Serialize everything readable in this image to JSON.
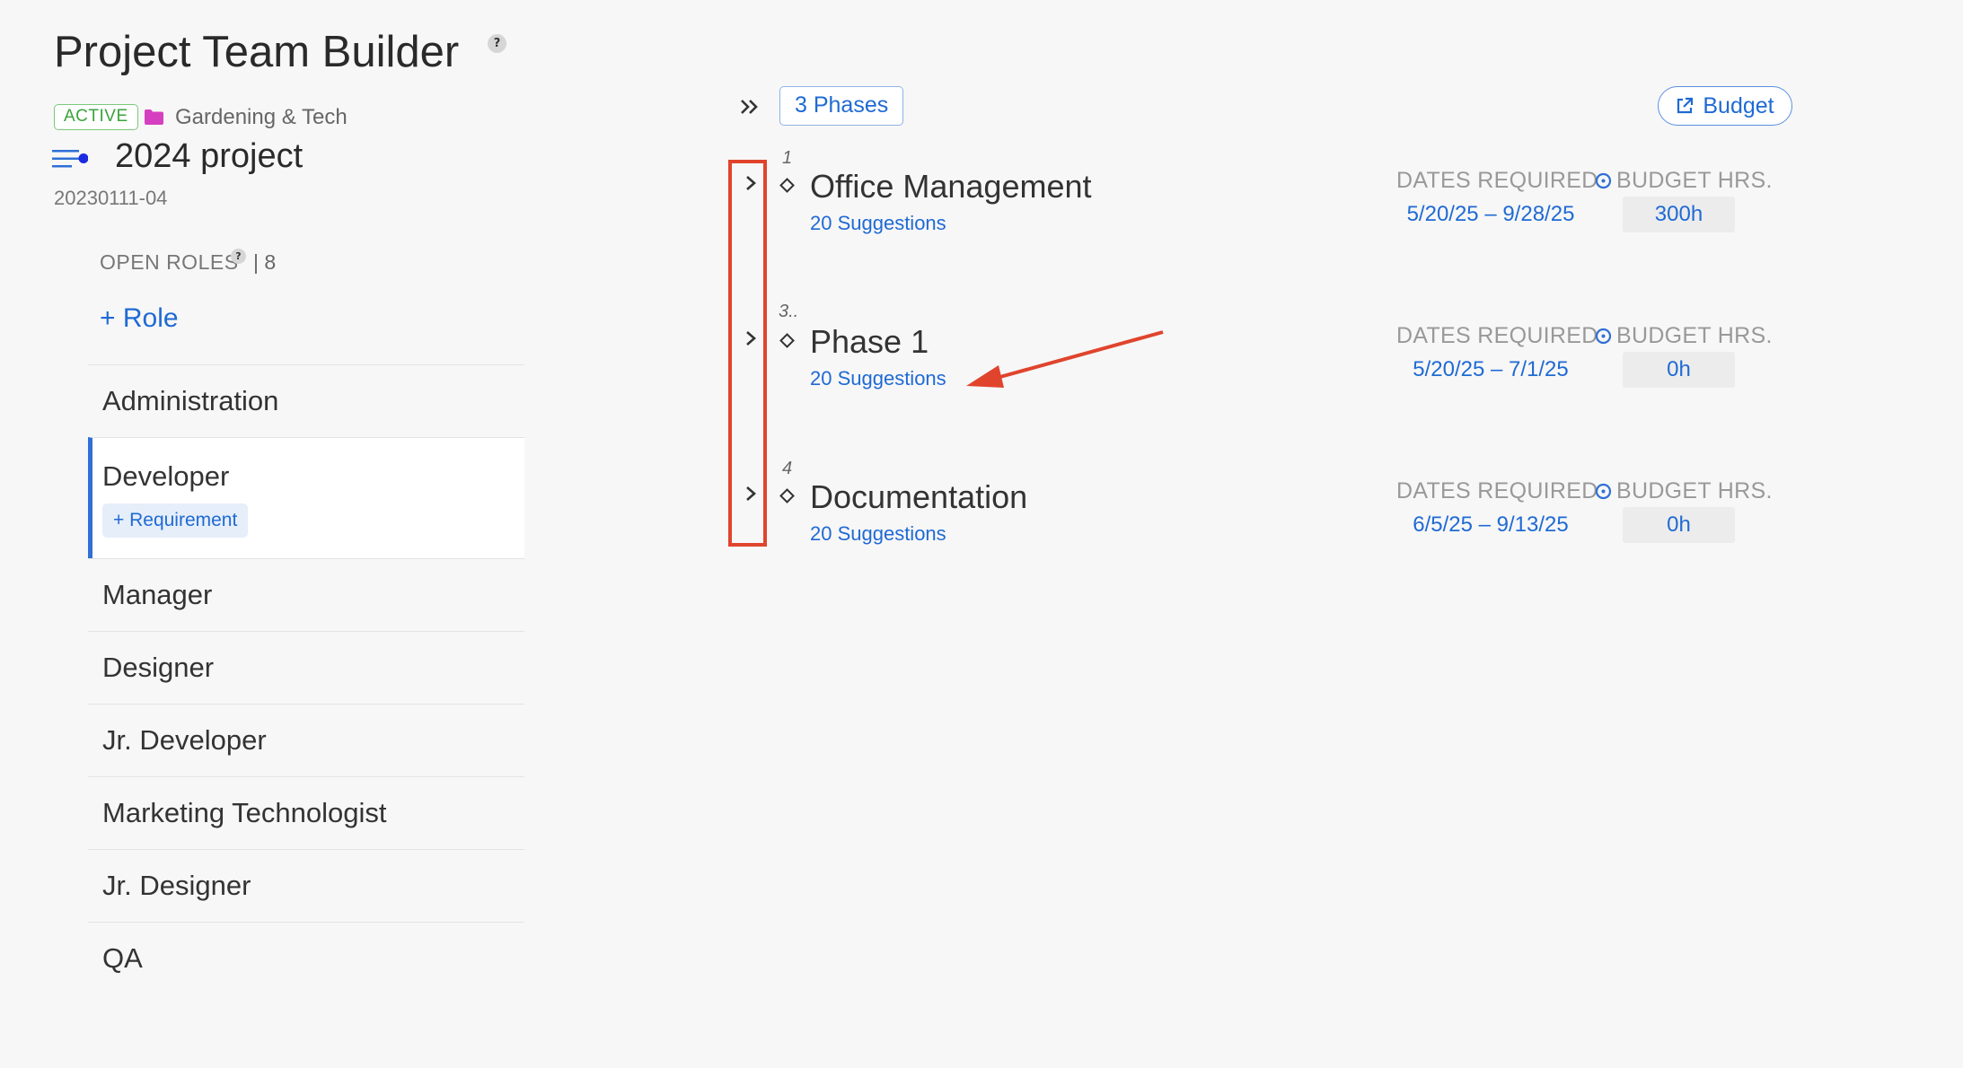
{
  "header": {
    "title": "Project Team Builder",
    "help": "?",
    "status": "ACTIVE",
    "client": "Gardening & Tech",
    "project_name": "2024 project",
    "project_code": "20230111-04"
  },
  "sidebar": {
    "open_roles_label": "OPEN ROLES",
    "open_roles_help": "?",
    "open_roles_count": "| 8",
    "add_role_label": "+ Role",
    "roles": [
      {
        "label": "Administration"
      },
      {
        "label": "Developer",
        "requirement_label": "+ Requirement"
      },
      {
        "label": "Manager"
      },
      {
        "label": "Designer"
      },
      {
        "label": "Jr. Developer"
      },
      {
        "label": "Marketing Technologist"
      },
      {
        "label": "Jr. Designer"
      },
      {
        "label": "QA"
      }
    ]
  },
  "toolbar": {
    "phases_label": "3 Phases",
    "budget_label": "Budget"
  },
  "phases": [
    {
      "number": "1",
      "name": "Office Management",
      "suggestions": "20 Suggestions",
      "dates_label": "DATES REQUIRED",
      "budget_label": "BUDGET HRS.",
      "dates": "5/20/25 – 9/28/25",
      "hours": "300h"
    },
    {
      "number": "3..",
      "name": "Phase 1",
      "suggestions": "20 Suggestions",
      "dates_label": "DATES REQUIRED",
      "budget_label": "BUDGET HRS.",
      "dates": "5/20/25 – 7/1/25",
      "hours": "0h"
    },
    {
      "number": "4",
      "name": "Documentation",
      "suggestions": "20 Suggestions",
      "dates_label": "DATES REQUIRED",
      "budget_label": "BUDGET HRS.",
      "dates": "6/5/25 – 9/13/25",
      "hours": "0h"
    }
  ],
  "colors": {
    "accent": "#1f6ad4",
    "active_badge": "#3aa33a",
    "folder": "#d63fbf",
    "annotation": "#e0442d"
  }
}
